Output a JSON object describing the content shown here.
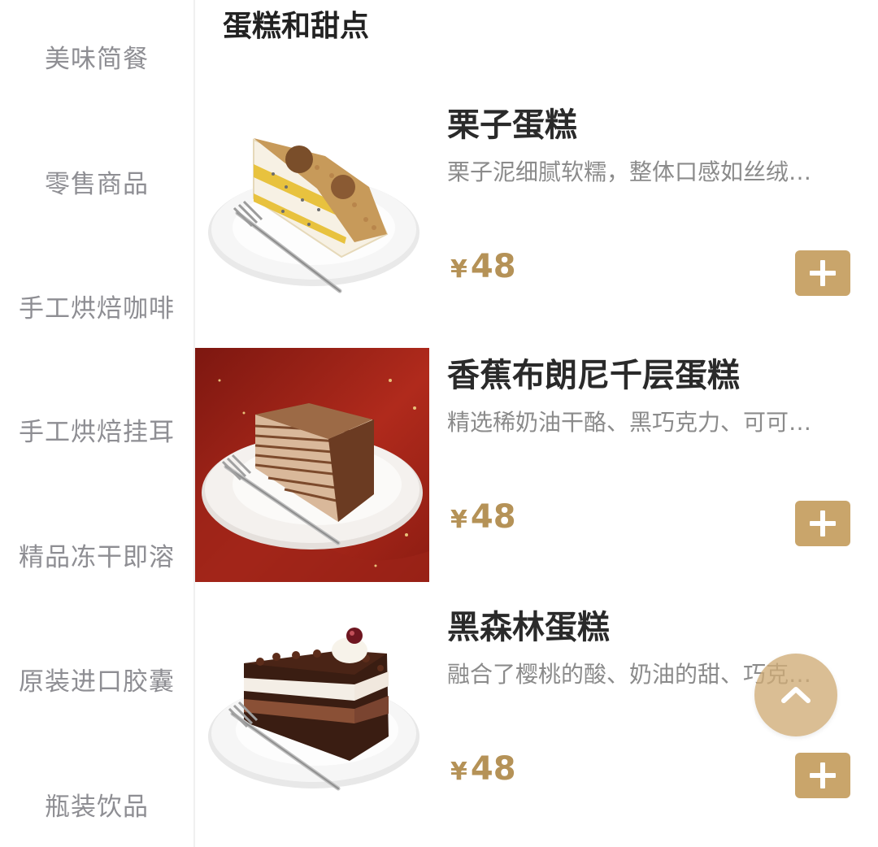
{
  "sidebar": {
    "items": [
      {
        "label": "美味简餐"
      },
      {
        "label": "零售商品"
      },
      {
        "label": "手工烘焙咖啡"
      },
      {
        "label": "手工烘焙挂耳"
      },
      {
        "label": "精品冻干即溶"
      },
      {
        "label": "原装进口胶囊"
      },
      {
        "label": "瓶装饮品"
      }
    ]
  },
  "main": {
    "section_title": "蛋糕和甜点",
    "products": [
      {
        "name": "栗子蛋糕",
        "desc": "栗子泥细腻软糯，整体口感如丝绒…",
        "currency": "¥",
        "price": "48",
        "image": "chestnut-cake-image"
      },
      {
        "name": "香蕉布朗尼千层蛋糕",
        "desc": "精选稀奶油干酪、黑巧克力、可可…",
        "currency": "¥",
        "price": "48",
        "image": "banana-brownie-crepe-cake-image"
      },
      {
        "name": "黑森林蛋糕",
        "desc": "融合了樱桃的酸、奶油的甜、巧克…",
        "currency": "¥",
        "price": "48",
        "image": "black-forest-cake-image"
      }
    ]
  },
  "icons": {
    "add": "plus-icon",
    "back_to_top": "chevron-up-icon"
  },
  "colors": {
    "accent": "#c9a56b",
    "price": "#b59257",
    "sidebar_text": "#8e8e93",
    "title": "#2a2a2a"
  }
}
